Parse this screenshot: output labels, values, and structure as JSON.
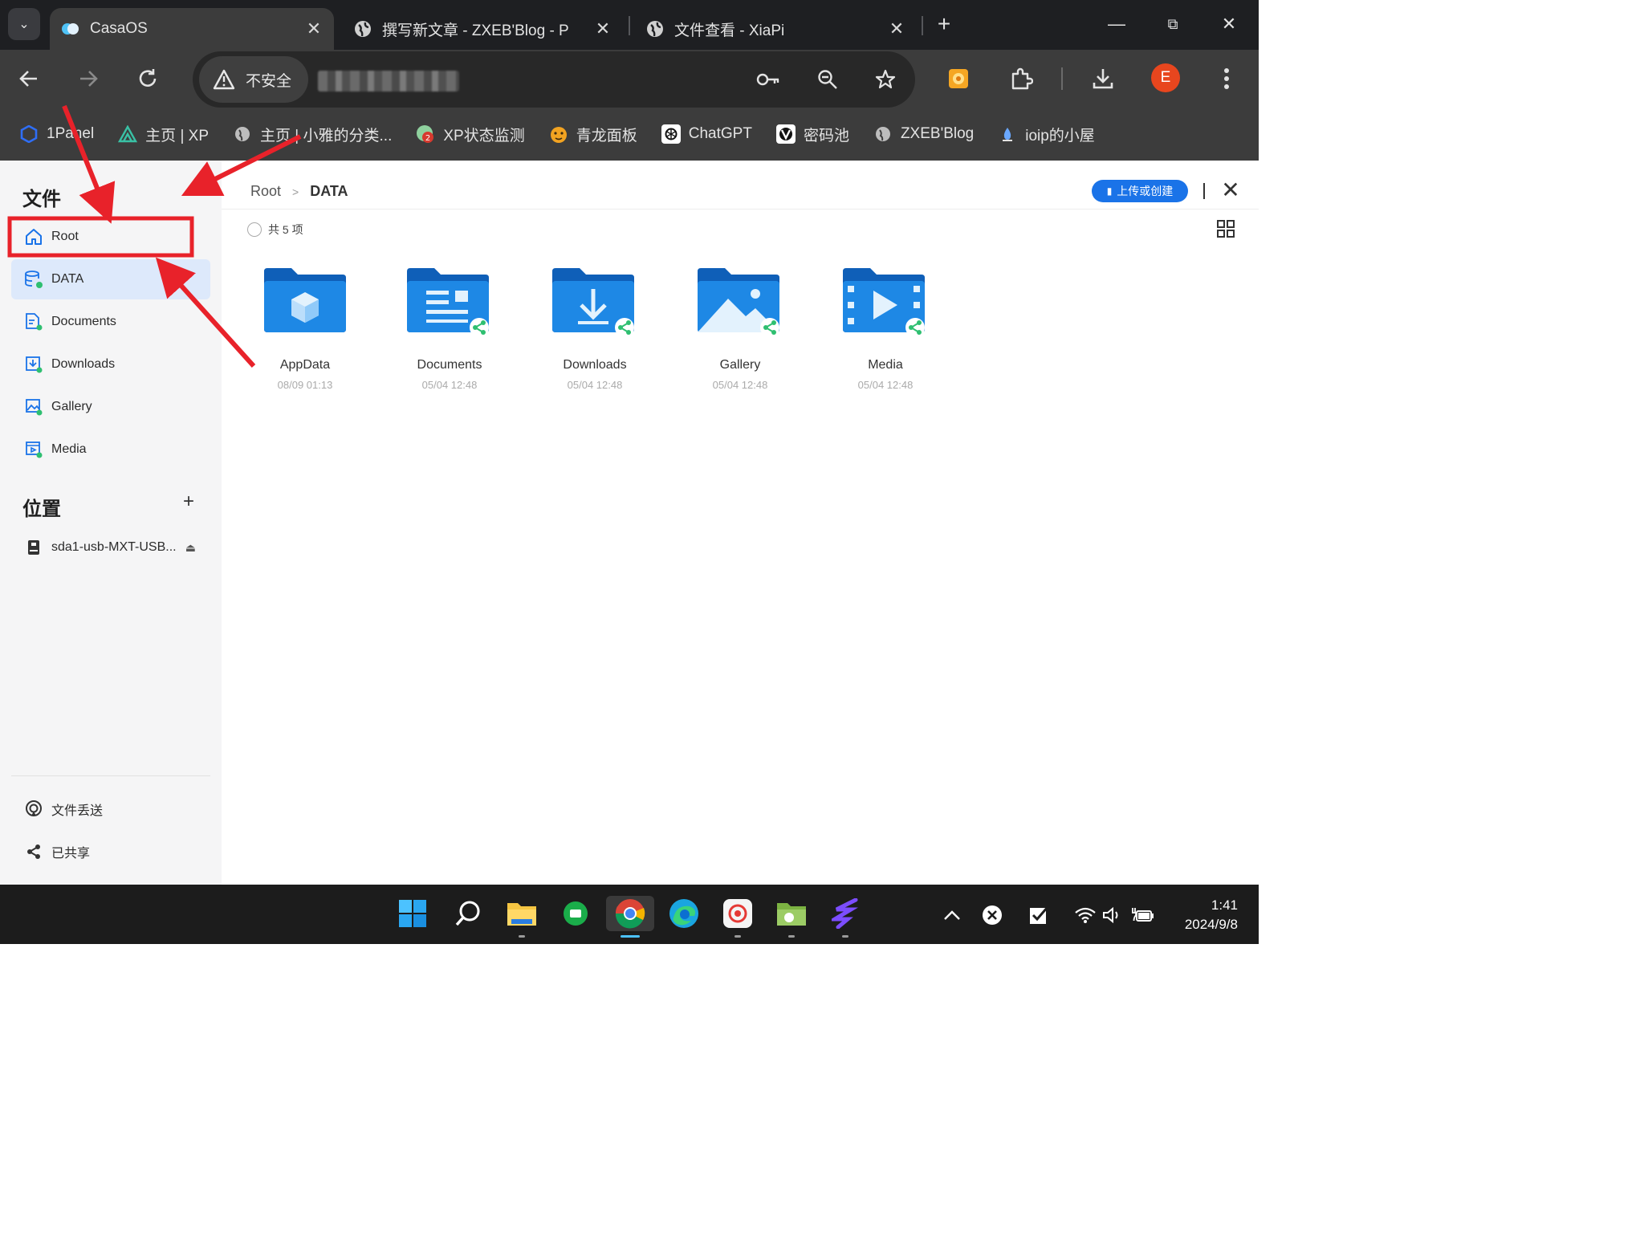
{
  "browser": {
    "tabs": [
      {
        "title": "CasaOS",
        "active": true
      },
      {
        "title": "撰写新文章 - ZXEB'Blog - P",
        "active": false
      },
      {
        "title": "文件查看 - XiaPi",
        "active": false
      }
    ],
    "security_label": "不安全",
    "profile_initial": "E",
    "bookmarks": [
      {
        "label": "1Panel",
        "icon": "hexagon-icon",
        "color": "#2f6ef5"
      },
      {
        "label": "主页 | XP",
        "icon": "mountain-icon",
        "color": "#39c1a5"
      },
      {
        "label": "主页 | 小雅的分类...",
        "icon": "globe-icon",
        "color": "#bdbdbd"
      },
      {
        "label": "XP状态监测",
        "icon": "badge-icon",
        "color": "#d73a2f"
      },
      {
        "label": "青龙面板",
        "icon": "tiger-icon",
        "color": "#f2a321"
      },
      {
        "label": "ChatGPT",
        "icon": "openai-icon",
        "color": "#ffffff"
      },
      {
        "label": "密码池",
        "icon": "vault-icon",
        "color": "#ffffff"
      },
      {
        "label": "ZXEB'Blog",
        "icon": "globe-icon",
        "color": "#bdbdbd"
      },
      {
        "label": "ioip的小屋",
        "icon": "drop-icon",
        "color": "#6aa8ff"
      }
    ]
  },
  "sidebar": {
    "files_title": "文件",
    "items": [
      {
        "label": "Root",
        "icon": "home-icon"
      },
      {
        "label": "DATA",
        "icon": "database-icon"
      },
      {
        "label": "Documents",
        "icon": "document-icon"
      },
      {
        "label": "Downloads",
        "icon": "download-icon"
      },
      {
        "label": "Gallery",
        "icon": "image-icon"
      },
      {
        "label": "Media",
        "icon": "video-icon"
      }
    ],
    "locations_title": "位置",
    "locations": [
      {
        "label": "sda1-usb-MXT-USB...",
        "icon": "usb-drive-icon"
      }
    ],
    "bottom": [
      {
        "label": "文件丢送",
        "icon": "airdrop-icon"
      },
      {
        "label": "已共享",
        "icon": "share-icon"
      }
    ]
  },
  "main": {
    "breadcrumb": {
      "root": "Root",
      "current": "DATA"
    },
    "upload_label": "上传或创建",
    "count_label": "共 5 项",
    "folders": [
      {
        "name": "AppData",
        "date": "08/09 01:13",
        "icon": "cube-folder-icon"
      },
      {
        "name": "Documents",
        "date": "05/04 12:48",
        "icon": "document-folder-icon"
      },
      {
        "name": "Downloads",
        "date": "05/04 12:48",
        "icon": "download-folder-icon"
      },
      {
        "name": "Gallery",
        "date": "05/04 12:48",
        "icon": "gallery-folder-icon"
      },
      {
        "name": "Media",
        "date": "05/04 12:48",
        "icon": "media-folder-icon"
      }
    ]
  },
  "taskbar": {
    "time": "1:41",
    "date": "2024/9/8"
  },
  "colors": {
    "accent": "#1a73e8",
    "annotation": "#e8222a",
    "folder_blue": "#1976d2"
  }
}
